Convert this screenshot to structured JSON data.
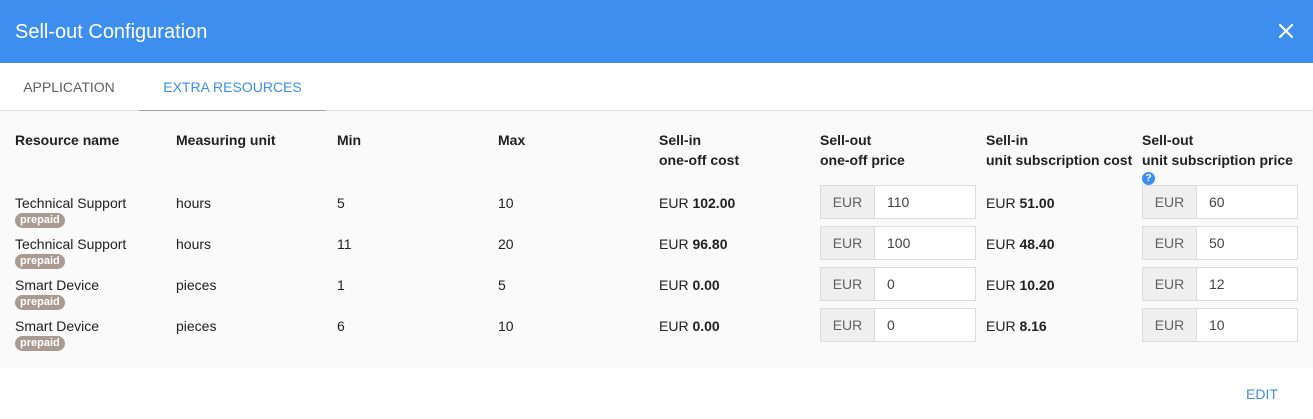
{
  "dialog": {
    "title": "Sell-out Configuration",
    "close_icon": "close-icon"
  },
  "tabs": [
    {
      "label": "APPLICATION",
      "active": false
    },
    {
      "label": "EXTRA RESOURCES",
      "active": true
    }
  ],
  "table": {
    "headers": {
      "resource_name": "Resource name",
      "measuring_unit": "Measuring unit",
      "min": "Min",
      "max": "Max",
      "sellin_oneoff_l1": "Sell-in",
      "sellin_oneoff_l2": "one-off cost",
      "sellout_oneoff_l1": "Sell-out",
      "sellout_oneoff_l2": "one-off price",
      "sellin_sub_l1": "Sell-in",
      "sellin_sub_l2": "unit subscription cost",
      "sellout_sub_l1": "Sell-out",
      "sellout_sub_l2": "unit subscription price",
      "help_icon": "help-icon"
    },
    "rows": [
      {
        "name": "Technical Support",
        "badge": "prepaid",
        "unit": "hours",
        "min": "5",
        "max": "10",
        "sellin_oneoff_cur": "EUR",
        "sellin_oneoff": "102.00",
        "sellout_oneoff_cur": "EUR",
        "sellout_oneoff": "110",
        "sellin_sub_cur": "EUR",
        "sellin_sub": "51.00",
        "sellout_sub_cur": "EUR",
        "sellout_sub": "60"
      },
      {
        "name": "Technical Support",
        "badge": "prepaid",
        "unit": "hours",
        "min": "11",
        "max": "20",
        "sellin_oneoff_cur": "EUR",
        "sellin_oneoff": "96.80",
        "sellout_oneoff_cur": "EUR",
        "sellout_oneoff": "100",
        "sellin_sub_cur": "EUR",
        "sellin_sub": "48.40",
        "sellout_sub_cur": "EUR",
        "sellout_sub": "50"
      },
      {
        "name": "Smart Device",
        "badge": "prepaid",
        "unit": "pieces",
        "min": "1",
        "max": "5",
        "sellin_oneoff_cur": "EUR",
        "sellin_oneoff": "0.00",
        "sellout_oneoff_cur": "EUR",
        "sellout_oneoff": "0",
        "sellin_sub_cur": "EUR",
        "sellin_sub": "10.20",
        "sellout_sub_cur": "EUR",
        "sellout_sub": "12"
      },
      {
        "name": "Smart Device",
        "badge": "prepaid",
        "unit": "pieces",
        "min": "6",
        "max": "10",
        "sellin_oneoff_cur": "EUR",
        "sellin_oneoff": "0.00",
        "sellout_oneoff_cur": "EUR",
        "sellout_oneoff": "0",
        "sellin_sub_cur": "EUR",
        "sellin_sub": "8.16",
        "sellout_sub_cur": "EUR",
        "sellout_sub": "10"
      }
    ]
  },
  "footer": {
    "edit_label": "EDIT"
  },
  "colors": {
    "header": "#3d8eef",
    "accent": "#3d8eef",
    "badge": "#a99b92"
  }
}
